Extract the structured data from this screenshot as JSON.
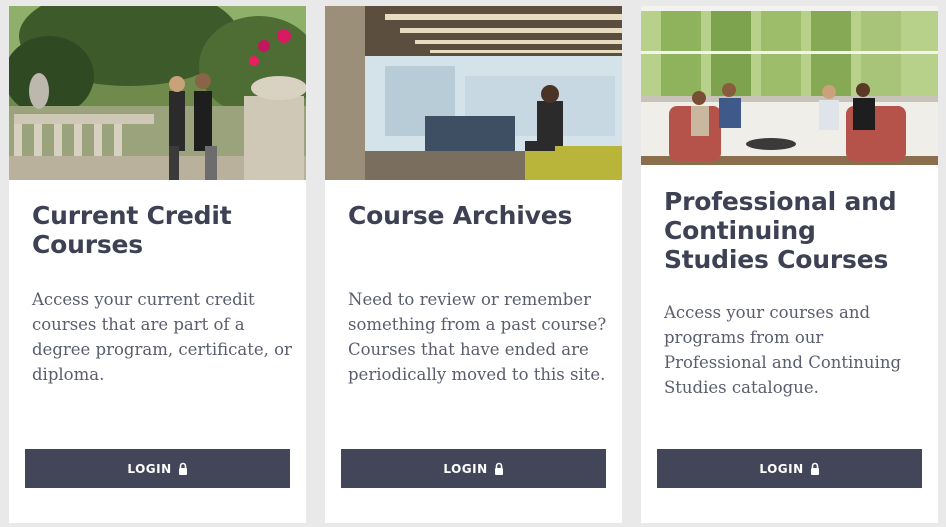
{
  "cards": [
    {
      "title": "Current Credit Courses",
      "description": "Access your current credit courses that are part of a degree program, certificate, or diploma.",
      "button_label": "LOGIN",
      "button_icon": "lock-icon",
      "photo": "students-in-garden-photo"
    },
    {
      "title": "Course Archives",
      "description": "Need to review or remember something from a past course? Courses that have ended are periodically moved to this site.",
      "button_label": "LOGIN",
      "button_icon": "lock-icon",
      "photo": "student-reading-in-library-photo"
    },
    {
      "title": "Professional and Continuing Studies Courses",
      "description": "Access your courses and programs from our Professional and Continuing Studies catalogue.",
      "button_label": "LOGIN",
      "button_icon": "lock-icon",
      "photo": "students-lounge-photo"
    }
  ],
  "colors": {
    "page_background": "#e9e9e9",
    "card_background": "#ffffff",
    "title_text": "#3e4153",
    "body_text": "#5a5d6d",
    "button_background": "#434658",
    "button_text": "#ffffff"
  }
}
